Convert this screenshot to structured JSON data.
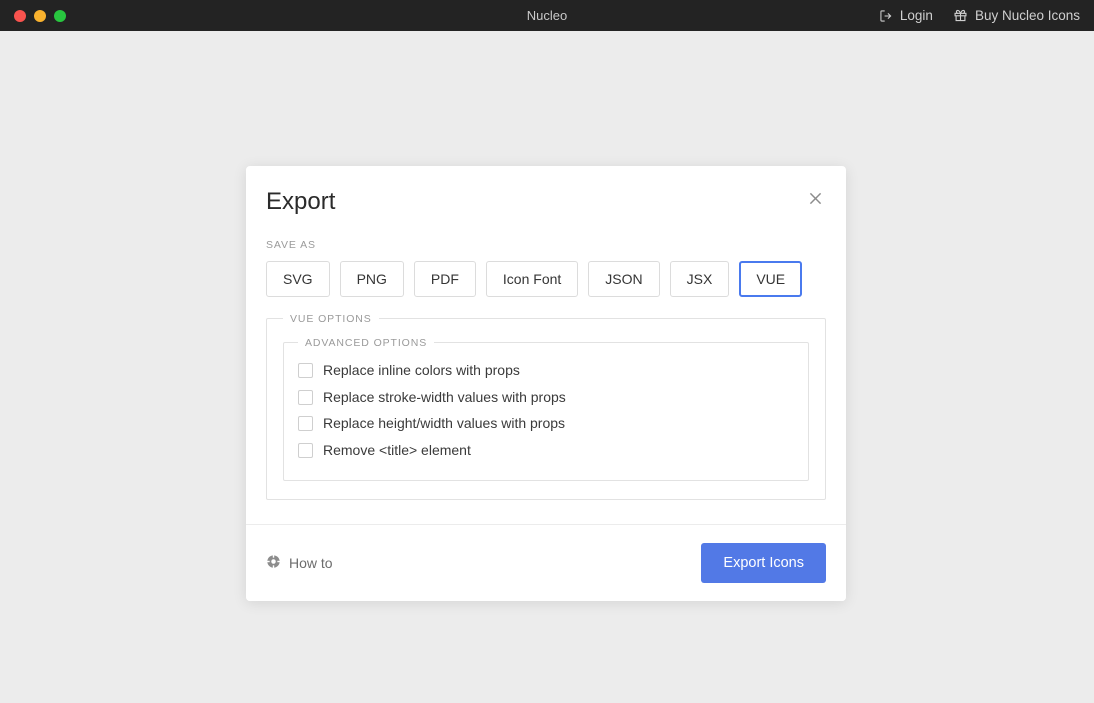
{
  "titlebar": {
    "window_title": "Nucleo",
    "traffic_lights": [
      {
        "name": "close",
        "color": "#f9534e"
      },
      {
        "name": "minimize",
        "color": "#f9b22e"
      },
      {
        "name": "maximize",
        "color": "#28c63f"
      }
    ],
    "actions": [
      {
        "icon": "sign-in-icon",
        "label": "Login"
      },
      {
        "icon": "gift-icon",
        "label": "Buy Nucleo Icons"
      }
    ]
  },
  "modal": {
    "title": "Export",
    "close_icon": "close-icon",
    "save_as_label": "SAVE AS",
    "formats": [
      {
        "label": "SVG",
        "selected": false
      },
      {
        "label": "PNG",
        "selected": false
      },
      {
        "label": "PDF",
        "selected": false
      },
      {
        "label": "Icon Font",
        "selected": false
      },
      {
        "label": "JSON",
        "selected": false
      },
      {
        "label": "JSX",
        "selected": false
      },
      {
        "label": "VUE",
        "selected": true
      }
    ],
    "selected_format": "VUE",
    "options_legend": "VUE OPTIONS",
    "advanced_legend": "ADVANCED OPTIONS",
    "checkboxes": [
      {
        "label": "Replace inline colors with props",
        "checked": false
      },
      {
        "label": "Replace stroke-width values with props",
        "checked": false
      },
      {
        "label": "Replace height/width values with props",
        "checked": false
      },
      {
        "label": "Remove <title> element",
        "checked": false
      }
    ],
    "footer": {
      "howto_icon": "help-circle-icon",
      "howto_label": "How to",
      "export_label": "Export Icons"
    }
  },
  "colors": {
    "accent": "#5279e6",
    "selected_border": "#4a7aee",
    "page_background": "#ececec",
    "titlebar_background": "#232323",
    "modal_background": "#ffffff"
  }
}
